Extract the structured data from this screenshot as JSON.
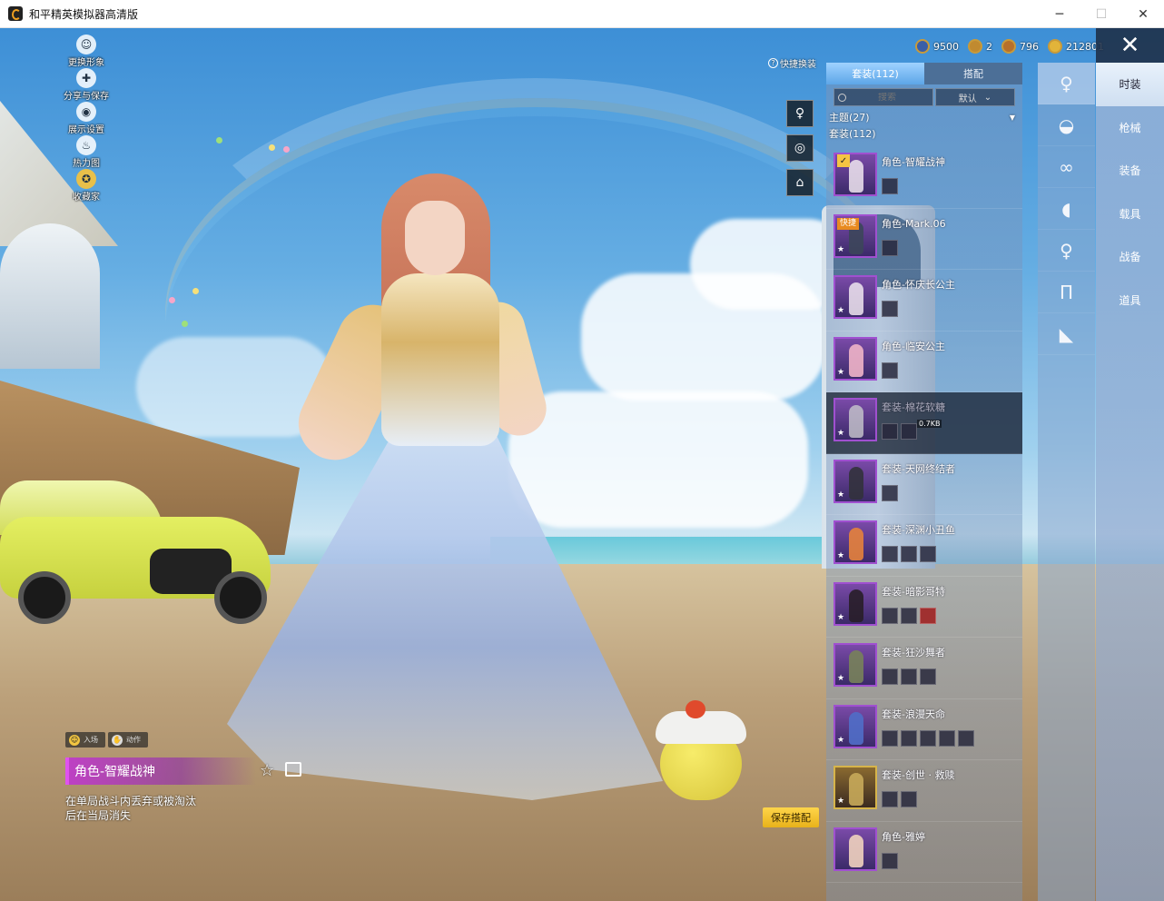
{
  "window": {
    "title": "和平精英模拟器高清版",
    "controls": {
      "minimize": "─",
      "maximize": "☐",
      "close": "✕"
    }
  },
  "left_menu": [
    {
      "label": "更换形象",
      "icon": "avatar-icon",
      "glyph": "☺"
    },
    {
      "label": "分享与保存",
      "icon": "share-icon",
      "glyph": "✚"
    },
    {
      "label": "展示设置",
      "icon": "eye-icon",
      "glyph": "◉"
    },
    {
      "label": "热力图",
      "icon": "flame-icon",
      "glyph": "♨"
    },
    {
      "label": "收藏家",
      "icon": "collector-icon",
      "glyph": "✪"
    }
  ],
  "currency": [
    {
      "icon": "coin-blue-icon",
      "value": "9500",
      "color": "#3a5ea8"
    },
    {
      "icon": "token-icon",
      "value": "2",
      "color": "#c08a30"
    },
    {
      "icon": "medal-icon",
      "value": "796",
      "color": "#b7702a"
    },
    {
      "icon": "gold-coin-icon",
      "value": "212801",
      "color": "#e2b43a"
    }
  ],
  "quick_change": {
    "label": "快捷换装",
    "help": "?"
  },
  "quick_slots": [
    {
      "icon": "figure-icon",
      "glyph": "♀"
    },
    {
      "icon": "badge-icon",
      "glyph": "◎"
    },
    {
      "icon": "wardrobe-icon",
      "glyph": "⌂"
    }
  ],
  "panel": {
    "tabs": [
      {
        "label": "套装(112)",
        "active": true
      },
      {
        "label": "搭配",
        "active": false
      }
    ],
    "search_placeholder": "搜索",
    "sort_label": "默认",
    "theme_line": "主题(27)",
    "suit_line": "套装(112)"
  },
  "items": [
    {
      "name": "角色-智耀战神",
      "tier": "purple",
      "subs": 1,
      "checked": true
    },
    {
      "name": "角色-Mark.06",
      "tier": "purple",
      "subs": 1,
      "quick_tag": "快捷"
    },
    {
      "name": "角色-怀庆长公主",
      "tier": "purple",
      "subs": 1
    },
    {
      "name": "角色-临安公主",
      "tier": "purple",
      "subs": 1
    },
    {
      "name": "套装-棉花软糖",
      "tier": "purple",
      "subs": 2,
      "selected": true,
      "download": "0.7KB"
    },
    {
      "name": "套装-天网终结者",
      "tier": "purple",
      "subs": 1
    },
    {
      "name": "套装-深渊小丑鱼",
      "tier": "purple",
      "subs": 3
    },
    {
      "name": "套装-暗影哥特",
      "tier": "purple",
      "subs": 3
    },
    {
      "name": "套装-狂沙舞者",
      "tier": "purple",
      "subs": 3
    },
    {
      "name": "套装-浪漫天命",
      "tier": "purple",
      "subs": 5
    },
    {
      "name": "套装-创世 · 救赎",
      "tier": "purple",
      "subs": 2
    },
    {
      "name": "角色-雅婷",
      "tier": "purple",
      "subs": 1
    }
  ],
  "category_icons": [
    {
      "icon": "full-body-icon",
      "glyph": "♀",
      "active": true
    },
    {
      "icon": "hat-icon",
      "glyph": "◒"
    },
    {
      "icon": "glasses-icon",
      "glyph": "∞"
    },
    {
      "icon": "mask-icon",
      "glyph": "◖"
    },
    {
      "icon": "dress-icon",
      "glyph": "♀"
    },
    {
      "icon": "pants-icon",
      "glyph": "Π"
    },
    {
      "icon": "shoes-icon",
      "glyph": "◣"
    }
  ],
  "main_nav": [
    {
      "label": "时装",
      "active": true
    },
    {
      "label": "枪械"
    },
    {
      "label": "装备"
    },
    {
      "label": "载具"
    },
    {
      "label": "战备"
    },
    {
      "label": "道具"
    }
  ],
  "bottom_info": {
    "tabs": [
      {
        "label": "入场",
        "icon": "smile-icon"
      },
      {
        "label": "动作",
        "icon": "gesture-icon"
      }
    ],
    "item_name": "角色-智耀战神",
    "description": "在单局战斗内丢弃或被淘汰后在当局消失",
    "save_button": "保存搭配"
  },
  "colors": {
    "accent": "#5da6e8",
    "rarity_purple": "#a050d0",
    "save_button": "#ffd54a"
  }
}
